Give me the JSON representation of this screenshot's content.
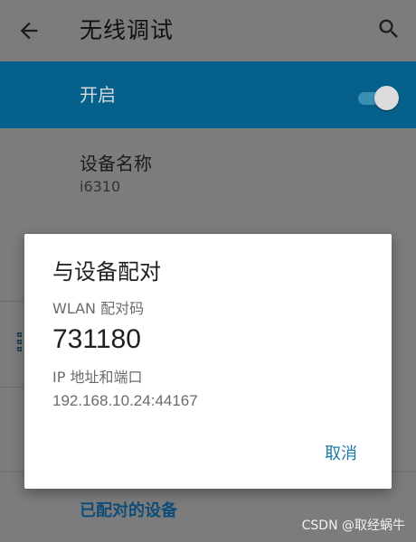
{
  "colors": {
    "accent": "#05618b",
    "dialog_button": "#1a7ba6",
    "scrim_background": "#7c7c7c",
    "paired_header": "#0f4c78"
  },
  "appbar": {
    "title": "无线调试",
    "back_icon": "arrow-left-icon",
    "search_icon": "search-icon"
  },
  "toggle": {
    "label": "开启",
    "state": "on"
  },
  "device_name": {
    "label": "设备名称",
    "value": "i6310"
  },
  "paired_section": {
    "header": "已配对的设备"
  },
  "dialog": {
    "title": "与设备配对",
    "code_label": "WLAN 配对码",
    "code_value": "731180",
    "ip_label": "IP 地址和端口",
    "ip_value": "192.168.10.24:44167",
    "cancel_label": "取消"
  },
  "watermark": "CSDN @取经蜗牛"
}
